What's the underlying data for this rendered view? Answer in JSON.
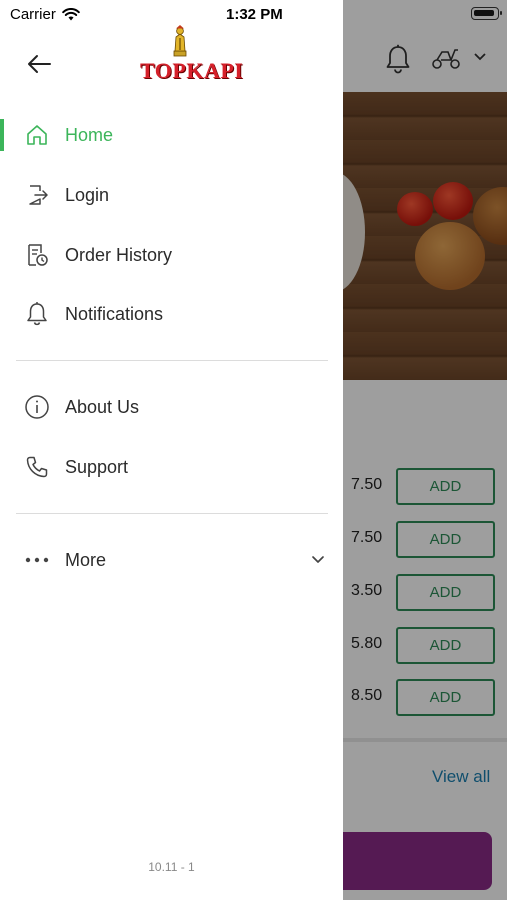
{
  "status_bar": {
    "carrier": "Carrier",
    "time": "1:32 PM"
  },
  "drawer": {
    "logo_text": "TOPKAPI",
    "menu": [
      {
        "label": "Home",
        "icon": "home-icon",
        "active": true
      },
      {
        "label": "Login",
        "icon": "login-icon",
        "active": false
      },
      {
        "label": "Order History",
        "icon": "order-history-icon",
        "active": false
      },
      {
        "label": "Notifications",
        "icon": "bell-icon",
        "active": false
      },
      {
        "label": "About Us",
        "icon": "info-icon",
        "active": false
      },
      {
        "label": "Support",
        "icon": "phone-icon",
        "active": false
      },
      {
        "label": "More",
        "icon": "more-dots-icon",
        "active": false
      }
    ],
    "version": "10.11 - 1"
  },
  "background": {
    "prices": [
      "7.50",
      "7.50",
      "3.50",
      "5.80",
      "8.50"
    ],
    "add_label": "ADD",
    "view_all": "View all"
  },
  "colors": {
    "accent_green": "#3cb55a",
    "logo_red": "#d6202a",
    "add_button_green": "#2e8b57",
    "cta_purple": "#8a2a86"
  }
}
